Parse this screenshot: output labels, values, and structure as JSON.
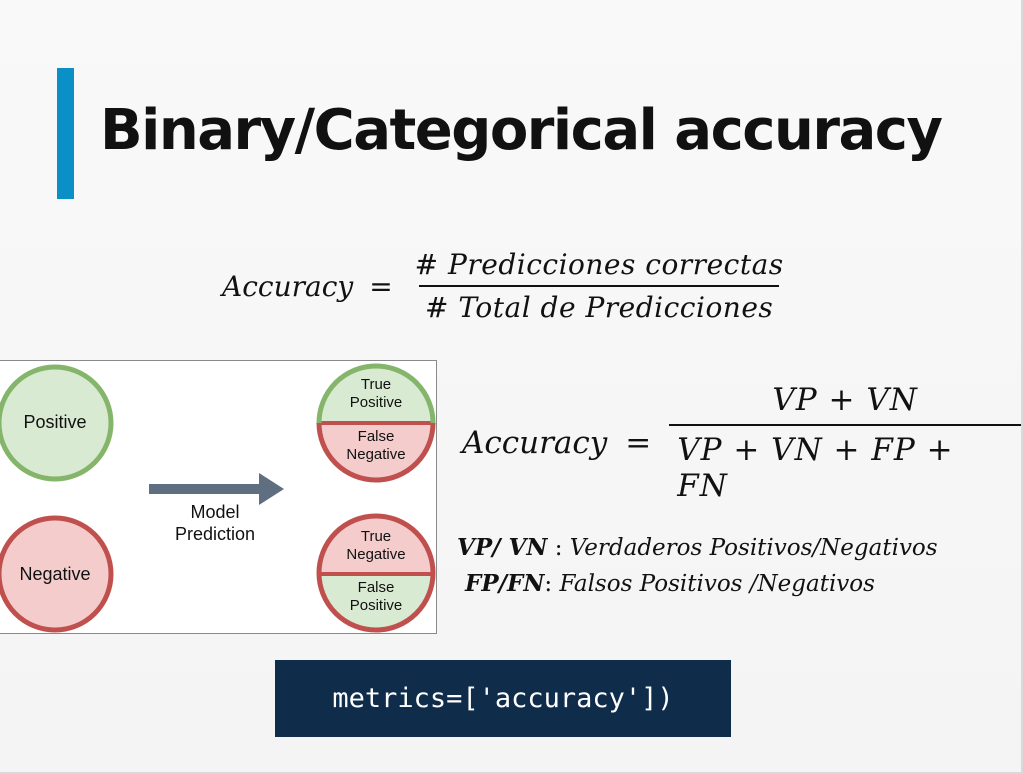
{
  "slide": {
    "title": "Binary/Categorical accuracy",
    "accent_color": "#0a8fc7",
    "code_bg_color": "#0f2c4a"
  },
  "formula1": {
    "lhs": "Accuracy",
    "equals": "=",
    "numerator": "# Predicciones correctas",
    "denominator": "# Total de Predicciones"
  },
  "diagram": {
    "actual_positive": "Positive",
    "actual_negative": "Negative",
    "arrow_label_line1": "Model",
    "arrow_label_line2": "Prediction",
    "pos_top_line1": "True",
    "pos_top_line2": "Positive",
    "pos_bottom_line1": "False",
    "pos_bottom_line2": "Negative",
    "neg_top_line1": "True",
    "neg_top_line2": "Negative",
    "neg_bottom_line1": "False",
    "neg_bottom_line2": "Positive",
    "colors": {
      "green_stroke": "#84b56a",
      "green_fill": "#d9ead3",
      "red_stroke": "#c0504d",
      "red_fill": "#f4cccc",
      "arrow": "#5f6e80"
    }
  },
  "formula2": {
    "lhs": "Accuracy",
    "equals": "=",
    "numerator": "VP + VN",
    "denominator": "VP + VN + FP + FN"
  },
  "definitions": [
    {
      "abbr": "VP/ VN",
      "sep": " : ",
      "text": "Verdaderos Positivos/Negativos"
    },
    {
      "abbr": "FP/FN",
      "sep": ": ",
      "text": "Falsos Positivos /Negativos"
    }
  ],
  "code": {
    "text": "metrics=['accuracy'])"
  }
}
